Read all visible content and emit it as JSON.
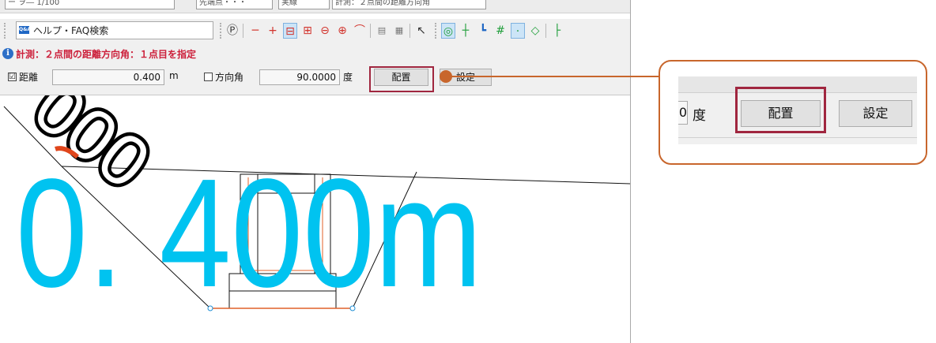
{
  "toolbar_top": {
    "field1": "ー ヲ― 1/100",
    "field2": "先端点・・・",
    "field3": "実線",
    "field4": "計測：２点間の距離方向角"
  },
  "help": {
    "icon_text": "Q&A",
    "label": "ヘルプ・FAQ検索"
  },
  "status": {
    "icon_text": "i",
    "message": "計測：２点間の距離方向角：１点目を指定"
  },
  "options": {
    "distance_check": "☑",
    "distance_label": "距離",
    "distance_value": "0.400",
    "distance_unit": "m",
    "angle_check": "",
    "angle_label": "方向角",
    "angle_value": "90.0000",
    "angle_unit": "度",
    "place_button": "配置",
    "settings_button": "設定"
  },
  "canvas": {
    "preview_text": "0. 400m",
    "rotated_text": "000"
  },
  "callout": {
    "partial_value": "0",
    "unit": "度",
    "place_button": "配置",
    "settings_button": "設定"
  },
  "colors": {
    "highlight": "#a0263f",
    "callout_border": "#c8662c",
    "preview_text": "#00c3f0",
    "status_text": "#cc1f3a"
  }
}
